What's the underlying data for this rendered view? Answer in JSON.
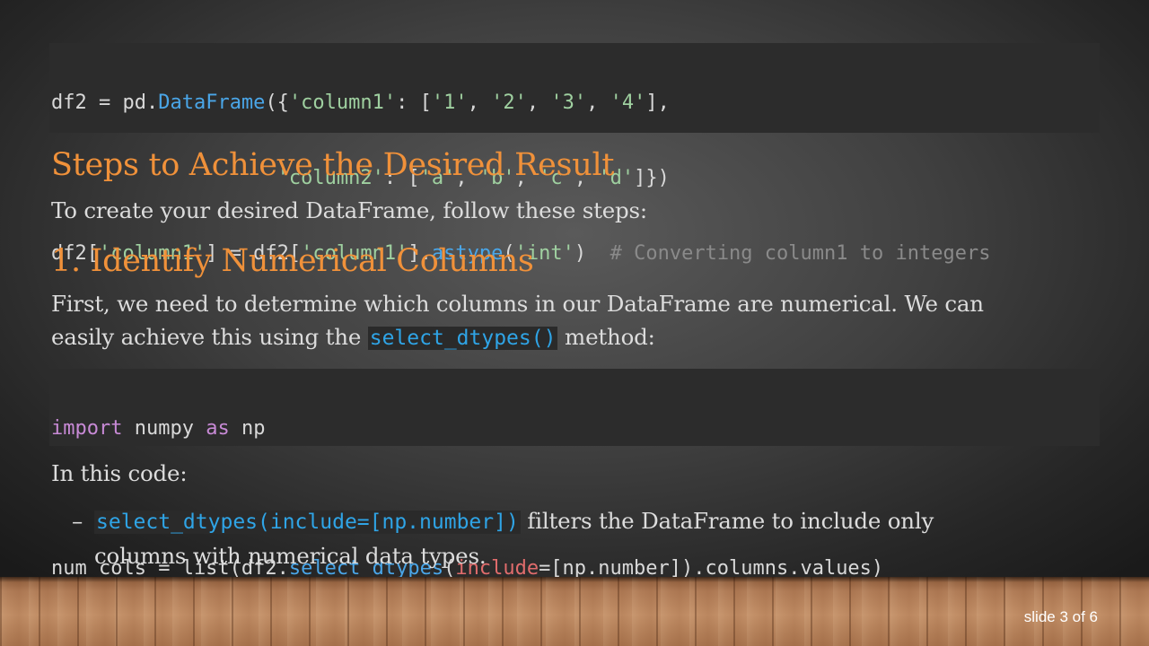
{
  "code1": {
    "l1_a": "df2 = pd.",
    "l1_fn": "DataFrame",
    "l1_b": "({",
    "l1_s1": "'column1'",
    "l1_c": ": [",
    "l1_s2": "'1'",
    "l1_d": ", ",
    "l1_s3": "'2'",
    "l1_e": ", ",
    "l1_s4": "'3'",
    "l1_f": ", ",
    "l1_s5": "'4'",
    "l1_g": "],",
    "l2_indent": "                   ",
    "l2_s1": "'column2'",
    "l2_c": ": [",
    "l2_s2": "'a'",
    "l2_d": ", ",
    "l2_s3": "'b'",
    "l2_e": ", ",
    "l2_s4": "'c'",
    "l2_f": ", ",
    "l2_s5": "'d'",
    "l2_g": "]})",
    "l3_a": "df2[",
    "l3_s1": "'column1'",
    "l3_b": "] = df2[",
    "l3_s2": "'column1'",
    "l3_c": "].",
    "l3_fn": "astype",
    "l3_d": "(",
    "l3_s3": "'int'",
    "l3_e": ")  ",
    "l3_com": "# Converting column1 to integers"
  },
  "heading1": "Steps to Achieve the Desired Result",
  "intro": "To create your desired DataFrame, follow these steps:",
  "heading2": "1. Identify Numerical Columns",
  "para1_a": "First, we need to determine which columns in our DataFrame are numerical. We can",
  "para1_b": "easily achieve this using the ",
  "para1_code": "select_dtypes()",
  "para1_c": " method:",
  "code2": {
    "l1_kw1": "import",
    "l1_a": " numpy ",
    "l1_kw2": "as",
    "l1_b": " np",
    "l3_a": "num_cols = list(df2.",
    "l3_fn": "select_dtypes",
    "l3_b": "(",
    "l3_arg": "include",
    "l3_c": "=[np.number]).columns.values)"
  },
  "in_this_code": "In this code:",
  "bullet": {
    "dash": "–",
    "code": "select_dtypes(include=[np.number])",
    "text_a": " filters the DataFrame to include only",
    "text_b": "columns with numerical data types."
  },
  "slide_number": "slide 3 of 6",
  "colors": {
    "heading": "#f0913a",
    "body_text": "#dcdcdc",
    "inline_code": "#2fa4e6",
    "code_bg": "#2c2c2c"
  }
}
